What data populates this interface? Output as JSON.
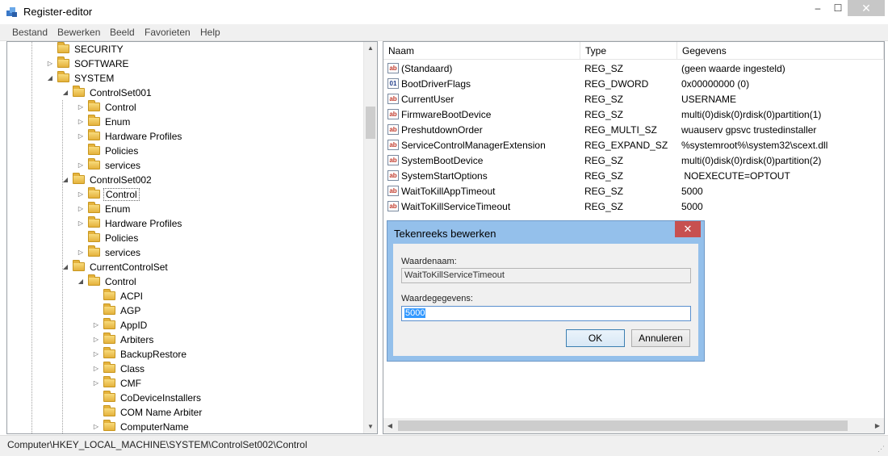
{
  "window": {
    "title": "Register-editor",
    "minimize": "–",
    "maximize": "☐",
    "close": "✕"
  },
  "menu": [
    "Bestand",
    "Bewerken",
    "Beeld",
    "Favorieten",
    "Help"
  ],
  "tree": [
    {
      "label": "SECURITY",
      "expander": "",
      "level": 0
    },
    {
      "label": "SOFTWARE",
      "expander": "▷",
      "level": 0
    },
    {
      "label": "SYSTEM",
      "expander": "◢",
      "level": 0
    },
    {
      "label": "ControlSet001",
      "expander": "◢",
      "level": 1
    },
    {
      "label": "Control",
      "expander": "▷",
      "level": 2
    },
    {
      "label": "Enum",
      "expander": "▷",
      "level": 2
    },
    {
      "label": "Hardware Profiles",
      "expander": "▷",
      "level": 2
    },
    {
      "label": "Policies",
      "expander": "",
      "level": 2
    },
    {
      "label": "services",
      "expander": "▷",
      "level": 2
    },
    {
      "label": "ControlSet002",
      "expander": "◢",
      "level": 1
    },
    {
      "label": "Control",
      "expander": "▷",
      "level": 2,
      "selected": true
    },
    {
      "label": "Enum",
      "expander": "▷",
      "level": 2
    },
    {
      "label": "Hardware Profiles",
      "expander": "▷",
      "level": 2
    },
    {
      "label": "Policies",
      "expander": "",
      "level": 2
    },
    {
      "label": "services",
      "expander": "▷",
      "level": 2
    },
    {
      "label": "CurrentControlSet",
      "expander": "◢",
      "level": 1
    },
    {
      "label": "Control",
      "expander": "◢",
      "level": 2
    },
    {
      "label": "ACPI",
      "expander": "",
      "level": 3
    },
    {
      "label": "AGP",
      "expander": "",
      "level": 3
    },
    {
      "label": "AppID",
      "expander": "▷",
      "level": 3
    },
    {
      "label": "Arbiters",
      "expander": "▷",
      "level": 3
    },
    {
      "label": "BackupRestore",
      "expander": "▷",
      "level": 3
    },
    {
      "label": "Class",
      "expander": "▷",
      "level": 3
    },
    {
      "label": "CMF",
      "expander": "▷",
      "level": 3
    },
    {
      "label": "CoDeviceInstallers",
      "expander": "",
      "level": 3
    },
    {
      "label": "COM Name Arbiter",
      "expander": "",
      "level": 3
    },
    {
      "label": "ComputerName",
      "expander": "▷",
      "level": 3
    }
  ],
  "columns": {
    "name": "Naam",
    "type": "Type",
    "data": "Gegevens"
  },
  "values": [
    {
      "name": "(Standaard)",
      "type": "REG_SZ",
      "data": "(geen waarde ingesteld)",
      "icon": "ab"
    },
    {
      "name": "BootDriverFlags",
      "type": "REG_DWORD",
      "data": "0x00000000 (0)",
      "icon": "bin"
    },
    {
      "name": "CurrentUser",
      "type": "REG_SZ",
      "data": "USERNAME",
      "icon": "ab"
    },
    {
      "name": "FirmwareBootDevice",
      "type": "REG_SZ",
      "data": "multi(0)disk(0)rdisk(0)partition(1)",
      "icon": "ab"
    },
    {
      "name": "PreshutdownOrder",
      "type": "REG_MULTI_SZ",
      "data": "wuauserv gpsvc trustedinstaller",
      "icon": "ab"
    },
    {
      "name": "ServiceControlManagerExtension",
      "type": "REG_EXPAND_SZ",
      "data": "%systemroot%\\system32\\scext.dll",
      "icon": "ab"
    },
    {
      "name": "SystemBootDevice",
      "type": "REG_SZ",
      "data": "multi(0)disk(0)rdisk(0)partition(2)",
      "icon": "ab"
    },
    {
      "name": "SystemStartOptions",
      "type": "REG_SZ",
      "data": " NOEXECUTE=OPTOUT",
      "icon": "ab"
    },
    {
      "name": "WaitToKillAppTimeout",
      "type": "REG_SZ",
      "data": "5000",
      "icon": "ab"
    },
    {
      "name": "WaitToKillServiceTimeout",
      "type": "REG_SZ",
      "data": "5000",
      "icon": "ab"
    }
  ],
  "dialog": {
    "title": "Tekenreeks bewerken",
    "close": "✕",
    "name_label": "Waardenaam:",
    "name_value": "WaitToKillServiceTimeout",
    "data_label": "Waardegegevens:",
    "data_value": "5000",
    "ok": "OK",
    "cancel": "Annuleren"
  },
  "status": {
    "path": "Computer\\HKEY_LOCAL_MACHINE\\SYSTEM\\ControlSet002\\Control"
  }
}
